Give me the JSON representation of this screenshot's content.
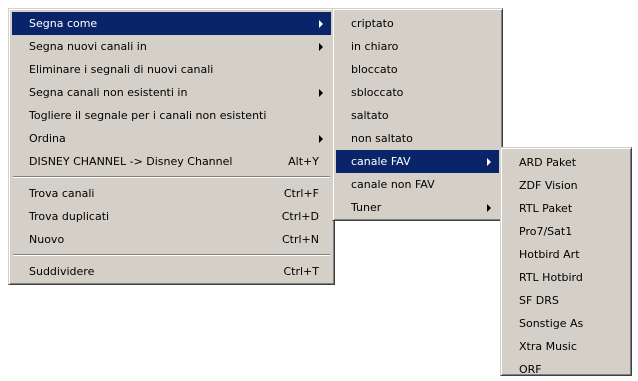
{
  "main_menu": {
    "items": [
      {
        "label": "Segna come",
        "shortcut": "",
        "has_submenu": true,
        "selected": true
      },
      {
        "label": "Segna nuovi canali in",
        "shortcut": "",
        "has_submenu": true,
        "selected": false
      },
      {
        "label": "Eliminare i segnali di nuovi canali",
        "shortcut": "",
        "has_submenu": false,
        "selected": false
      },
      {
        "label": "Segna canali non esistenti in",
        "shortcut": "",
        "has_submenu": true,
        "selected": false
      },
      {
        "label": "Togliere il segnale per i canali non esistenti",
        "shortcut": "",
        "has_submenu": false,
        "selected": false
      },
      {
        "label": "Ordina",
        "shortcut": "",
        "has_submenu": true,
        "selected": false
      },
      {
        "label": "DISNEY CHANNEL -> Disney Channel",
        "shortcut": "Alt+Y",
        "has_submenu": false,
        "selected": false
      },
      {
        "separator": true
      },
      {
        "label": "Trova canali",
        "shortcut": "Ctrl+F",
        "has_submenu": false,
        "selected": false
      },
      {
        "label": "Trova duplicati",
        "shortcut": "Ctrl+D",
        "has_submenu": false,
        "selected": false
      },
      {
        "label": "Nuovo",
        "shortcut": "Ctrl+N",
        "has_submenu": false,
        "selected": false
      },
      {
        "separator": true
      },
      {
        "label": "Suddividere",
        "shortcut": "Ctrl+T",
        "has_submenu": false,
        "selected": false
      }
    ]
  },
  "submenu_segna_come": {
    "items": [
      {
        "label": "criptato",
        "has_submenu": false,
        "selected": false
      },
      {
        "label": "in chiaro",
        "has_submenu": false,
        "selected": false
      },
      {
        "label": "bloccato",
        "has_submenu": false,
        "selected": false
      },
      {
        "label": "sbloccato",
        "has_submenu": false,
        "selected": false
      },
      {
        "label": "saltato",
        "has_submenu": false,
        "selected": false
      },
      {
        "label": "non saltato",
        "has_submenu": false,
        "selected": false
      },
      {
        "label": "canale FAV",
        "has_submenu": true,
        "selected": true
      },
      {
        "label": "canale non FAV",
        "has_submenu": false,
        "selected": false
      },
      {
        "label": "Tuner",
        "has_submenu": true,
        "selected": false
      }
    ]
  },
  "submenu_canale_fav": {
    "items": [
      {
        "label": "ARD Paket"
      },
      {
        "label": "ZDF Vision"
      },
      {
        "label": "RTL Paket"
      },
      {
        "label": "Pro7/Sat1"
      },
      {
        "label": "Hotbird Art"
      },
      {
        "label": "RTL Hotbird"
      },
      {
        "label": "SF DRS"
      },
      {
        "label": "Sonstige As"
      },
      {
        "label": "Xtra Music"
      },
      {
        "label": "ORF"
      }
    ]
  },
  "colors": {
    "menu_bg": "#d4d0c8",
    "highlight_bg": "#0a246a",
    "highlight_text": "#ffffff"
  },
  "icons": {
    "submenu_arrow": "triangle-right"
  }
}
